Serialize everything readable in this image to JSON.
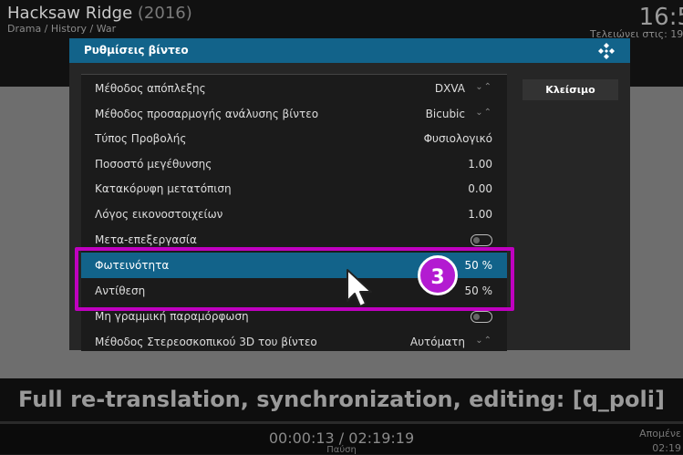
{
  "background": {
    "movie_title": "Hacksaw Ridge",
    "movie_year": "(2016)",
    "genres": "Drama / History / War",
    "clock": "16:5",
    "ends_at": "Τελειώνει στις: 19:",
    "subtitle": "Full re-translation, synchronization, editing: [q_poli]",
    "time_readout": "00:00:13 / 02:19:19",
    "pause_label": "Παύση",
    "next_label": "Απομένε",
    "next_time": "02:19"
  },
  "dialog": {
    "title": "Ρυθμίσεις βίντεο",
    "close_label": "Κλείσιμο",
    "rows": [
      {
        "label": "Μέθοδος απόπλεξης",
        "value": "DXVA",
        "spinner": "⌄⌃"
      },
      {
        "label": "Μέθοδος προσαρμογής ανάλυσης βίντεο",
        "value": "Bicubic",
        "spinner": "⌄⌃"
      },
      {
        "label": "Τύπος Προβολής",
        "value": "Φυσιολογικό"
      },
      {
        "label": "Ποσοστό μεγέθυνσης",
        "value": "1.00"
      },
      {
        "label": "Κατακόρυφη μετατόπιση",
        "value": "0.00"
      },
      {
        "label": "Λόγος εικονοστοιχείων",
        "value": "1.00"
      },
      {
        "label": "Μετα-επεξεργασία",
        "toggle": "off"
      },
      {
        "label": "Φωτεινότητα",
        "value": "50 %",
        "focused": true
      },
      {
        "label": "Αντίθεση",
        "value": "50 %"
      },
      {
        "label": "Μη γραμμική παραμόρφωση",
        "toggle": "off"
      },
      {
        "label": "Μέθοδος Στερεοσκοπικού 3D του βίντεο",
        "value": "Αυτόματη",
        "spinner": "⌄⌃"
      }
    ]
  },
  "annotation": {
    "step_number": "3",
    "highlight_color": "#c000c0",
    "badge_color": "#b31bd1"
  },
  "colors": {
    "accent": "#12638a",
    "dialog_bg": "#262626"
  },
  "icons": [
    "kodi-logo-icon",
    "spinner-arrows-icon",
    "toggle-icon",
    "mouse-cursor-icon"
  ]
}
